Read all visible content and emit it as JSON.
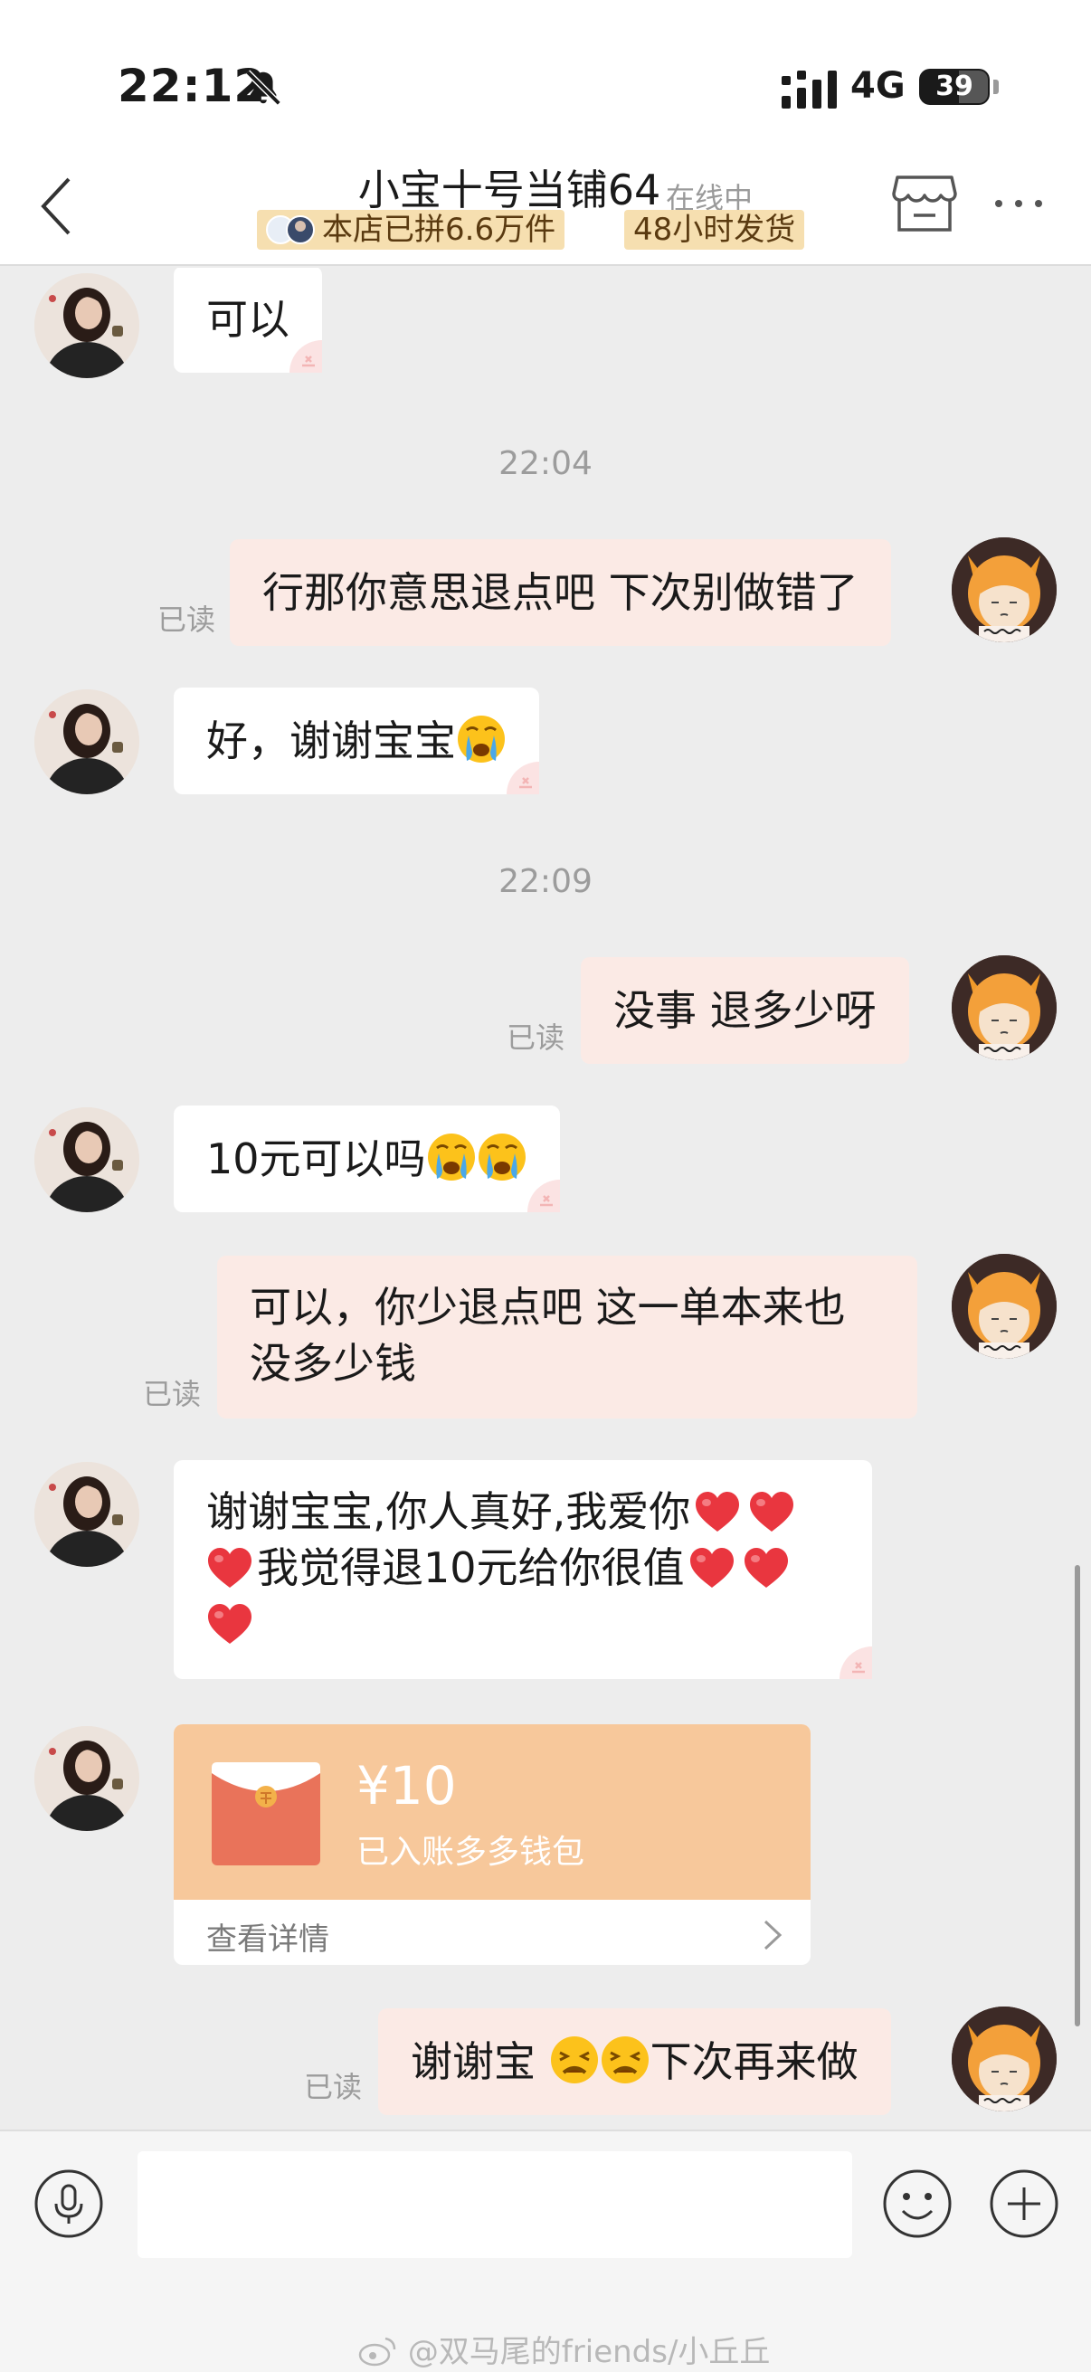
{
  "status_bar": {
    "time": "22:12",
    "network": "4G",
    "battery": "39",
    "battery_fraction": 0.39
  },
  "header": {
    "shop_name": "小宝十号当铺64",
    "online_status": "在线中",
    "tag_sold": "本店已拼6.6万件",
    "tag_ship": "48小时发货"
  },
  "messages": [
    {
      "side": "left",
      "text": "可以"
    },
    {
      "type": "time",
      "text": "22:04"
    },
    {
      "side": "right",
      "text": "行那你意思退点吧 下次别做错了",
      "read": "已读"
    },
    {
      "side": "left",
      "text": "好，谢谢宝宝"
    },
    {
      "type": "time",
      "text": "22:09"
    },
    {
      "side": "right",
      "text": "没事 退多少呀",
      "read": "已读"
    },
    {
      "side": "left",
      "text": "10元可以吗"
    },
    {
      "side": "right",
      "line1": "可以，你少退点吧 这一单本来也",
      "line2": "没多少钱",
      "read": "已读"
    },
    {
      "side": "left",
      "line1": "谢谢宝宝,你人真好,我爱你",
      "line2": "我觉得退10元给你很值"
    },
    {
      "type": "red_packet",
      "amount": "¥10",
      "status": "已入账多多钱包",
      "detail": "查看详情"
    },
    {
      "side": "right",
      "text_a": "谢谢宝",
      "text_b": "下次再来做",
      "read": "已读"
    }
  ],
  "input": {
    "placeholder": ""
  },
  "watermark": "@双马尾的friends/小丘丘",
  "colors": {
    "bubble_right": "#fbeae5",
    "bubble_left": "#ffffff",
    "chat_bg": "#ededed",
    "packet": "#f7c89b",
    "tag": "#f6dfb0"
  },
  "icons": [
    "bell-off-icon",
    "signal-icon",
    "back-icon",
    "store-icon",
    "more-icon",
    "voice-icon",
    "emoji-icon",
    "plus-icon"
  ]
}
